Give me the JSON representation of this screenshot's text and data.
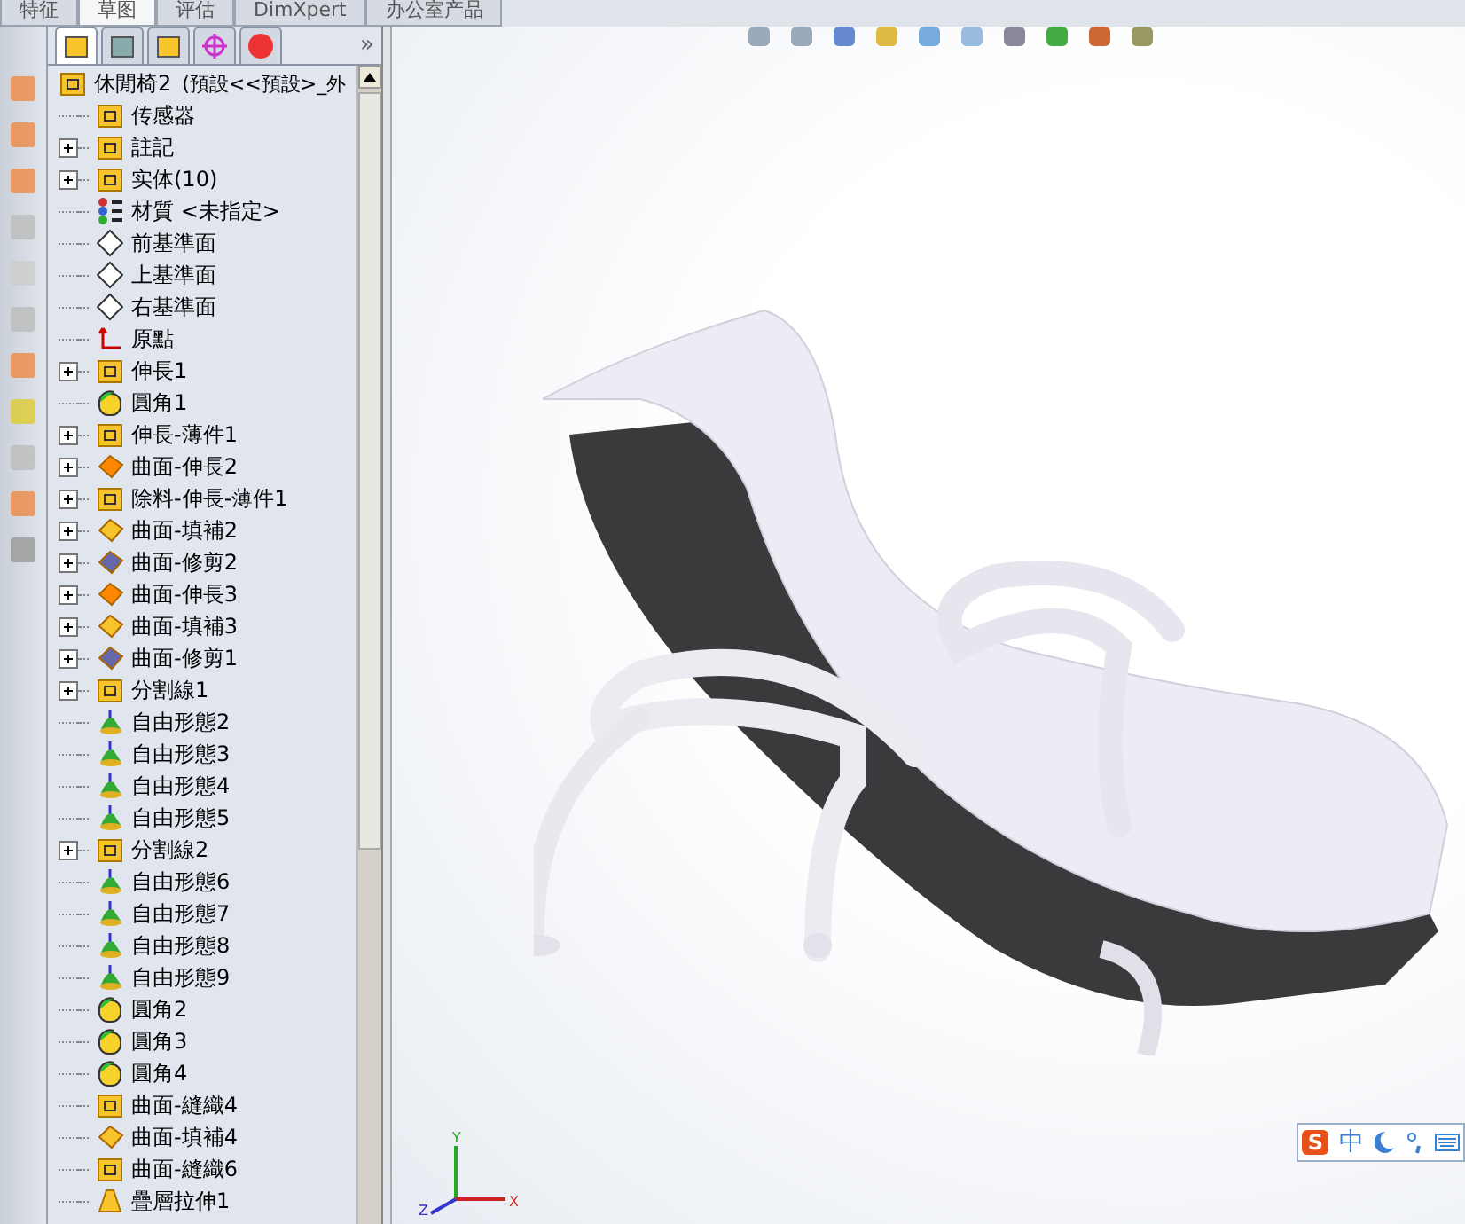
{
  "top_tabs": [
    {
      "label": "特征",
      "selected": false
    },
    {
      "label": "草图",
      "selected": true
    },
    {
      "label": "评估",
      "selected": false
    },
    {
      "label": "DimXpert",
      "selected": false
    },
    {
      "label": "办公室产品",
      "selected": false
    }
  ],
  "panel_tabs": [
    {
      "kind": "tree",
      "selected": true
    },
    {
      "kind": "property",
      "selected": false
    },
    {
      "kind": "config",
      "selected": false
    },
    {
      "kind": "dim",
      "selected": false
    },
    {
      "kind": "display",
      "selected": false
    }
  ],
  "panel_more": "»",
  "tree": {
    "root": {
      "name": "休閒椅2",
      "config": "(預設<<預設>_外"
    },
    "items": [
      {
        "label": "传感器",
        "kind": "sensor",
        "expandable": false
      },
      {
        "label": "註記",
        "kind": "annotation",
        "expandable": true
      },
      {
        "label": "实体(10)",
        "kind": "body",
        "expandable": true
      },
      {
        "label": "材質 <未指定>",
        "kind": "material",
        "expandable": false
      },
      {
        "label": "前基準面",
        "kind": "plane",
        "expandable": false
      },
      {
        "label": "上基準面",
        "kind": "plane",
        "expandable": false
      },
      {
        "label": "右基準面",
        "kind": "plane",
        "expandable": false
      },
      {
        "label": "原點",
        "kind": "origin",
        "expandable": false
      },
      {
        "label": "伸長1",
        "kind": "extrude",
        "expandable": true
      },
      {
        "label": "圓角1",
        "kind": "fillet",
        "expandable": false
      },
      {
        "label": "伸長-薄件1",
        "kind": "extrude",
        "expandable": true
      },
      {
        "label": "曲面-伸長2",
        "kind": "surface",
        "expandable": true
      },
      {
        "label": "除料-伸長-薄件1",
        "kind": "cut",
        "expandable": true
      },
      {
        "label": "曲面-填補2",
        "kind": "fill",
        "expandable": true
      },
      {
        "label": "曲面-修剪2",
        "kind": "trim",
        "expandable": true
      },
      {
        "label": "曲面-伸長3",
        "kind": "surface",
        "expandable": true
      },
      {
        "label": "曲面-填補3",
        "kind": "fill",
        "expandable": true
      },
      {
        "label": "曲面-修剪1",
        "kind": "trim",
        "expandable": true
      },
      {
        "label": "分割線1",
        "kind": "split",
        "expandable": true
      },
      {
        "label": "自由形態2",
        "kind": "freeform",
        "expandable": false
      },
      {
        "label": "自由形態3",
        "kind": "freeform",
        "expandable": false
      },
      {
        "label": "自由形態4",
        "kind": "freeform",
        "expandable": false
      },
      {
        "label": "自由形態5",
        "kind": "freeform",
        "expandable": false
      },
      {
        "label": "分割線2",
        "kind": "split",
        "expandable": true
      },
      {
        "label": "自由形態6",
        "kind": "freeform",
        "expandable": false
      },
      {
        "label": "自由形態7",
        "kind": "freeform",
        "expandable": false
      },
      {
        "label": "自由形態8",
        "kind": "freeform",
        "expandable": false
      },
      {
        "label": "自由形態9",
        "kind": "freeform",
        "expandable": false
      },
      {
        "label": "圓角2",
        "kind": "fillet",
        "expandable": false
      },
      {
        "label": "圓角3",
        "kind": "fillet",
        "expandable": false
      },
      {
        "label": "圓角4",
        "kind": "fillet",
        "expandable": false
      },
      {
        "label": "曲面-縫織4",
        "kind": "knit",
        "expandable": false
      },
      {
        "label": "曲面-填補4",
        "kind": "fill",
        "expandable": false
      },
      {
        "label": "曲面-縫織6",
        "kind": "knit",
        "expandable": false
      },
      {
        "label": "疊層拉伸1",
        "kind": "loft",
        "expandable": false
      }
    ]
  },
  "ime": {
    "logo": "S",
    "mode": "中"
  },
  "triad": {
    "y": "Y",
    "x": "X",
    "z": "Z"
  }
}
